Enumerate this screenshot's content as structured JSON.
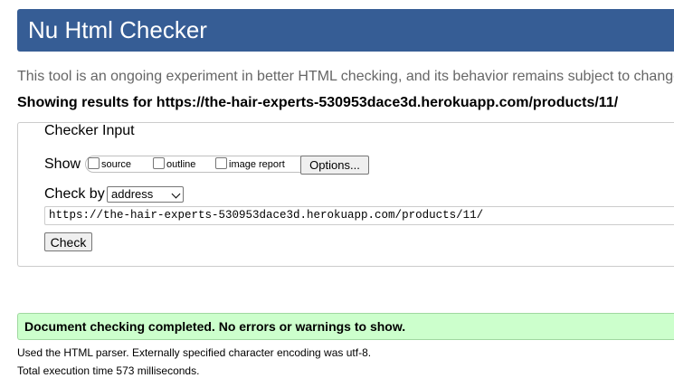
{
  "header": {
    "title": "Nu Html Checker"
  },
  "intro_text": "This tool is an ongoing experiment in better HTML checking, and its behavior remains subject to change",
  "showing_results": "Showing results for https://the-hair-experts-530953dace3d.herokuapp.com/products/11/",
  "checker_input": {
    "legend": "Checker Input",
    "show_label": "Show",
    "options": [
      {
        "label": "source",
        "checked": false
      },
      {
        "label": "outline",
        "checked": false
      },
      {
        "label": "image report",
        "checked": false
      }
    ],
    "options_button": "Options...",
    "check_by_label": "Check by",
    "check_by_value": "address",
    "url_value": "https://the-hair-experts-530953dace3d.herokuapp.com/products/11/",
    "check_button": "Check"
  },
  "result": {
    "success_message": "Document checking completed. No errors or warnings to show.",
    "parser_note": "Used the HTML parser. Externally specified character encoding was utf-8.",
    "execution_time": "Total execution time 573 milliseconds."
  },
  "colors": {
    "header_bg": "#365d95",
    "success_bg": "#ccffcc"
  }
}
